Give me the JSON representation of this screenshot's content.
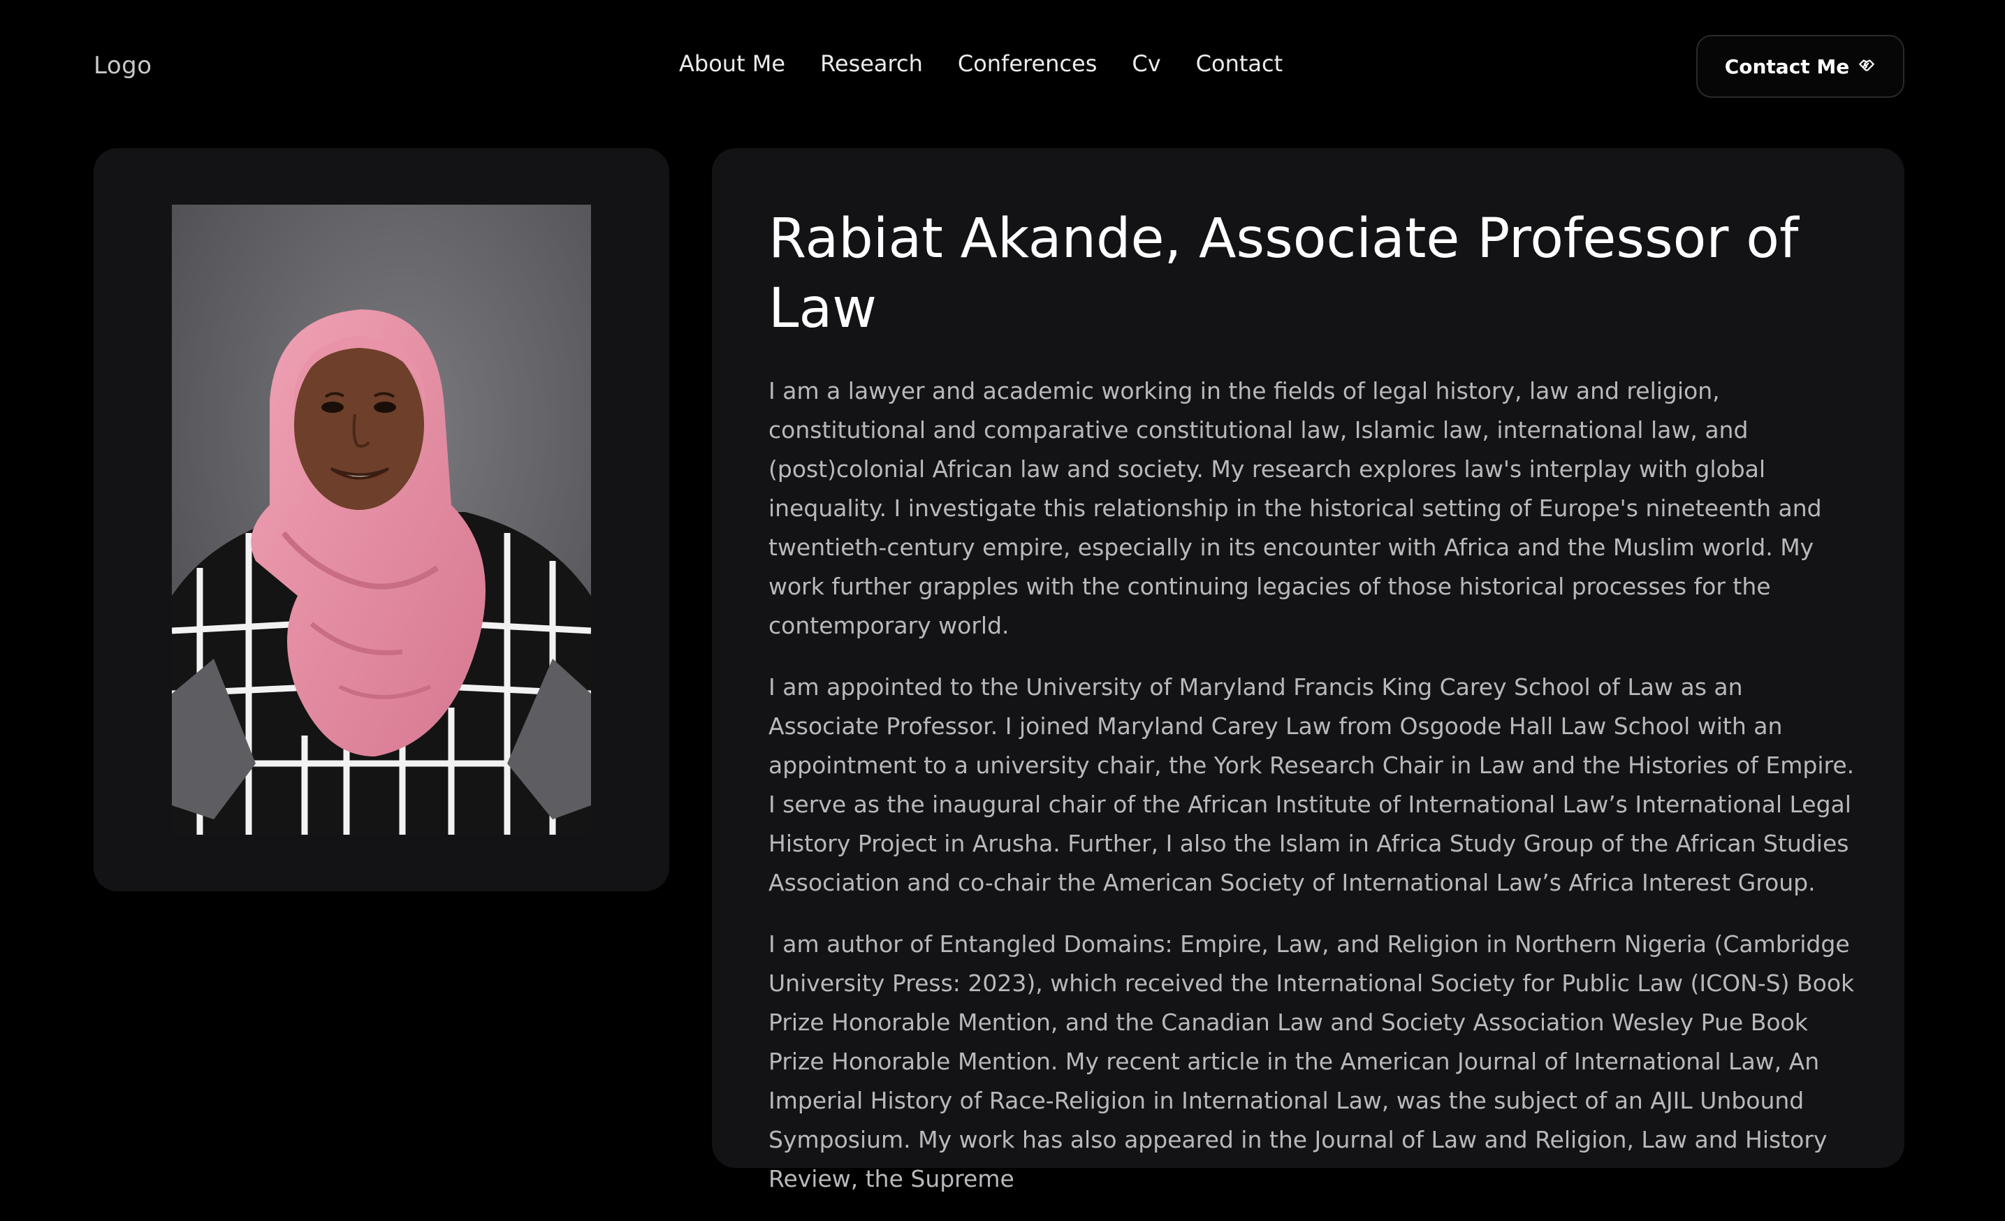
{
  "header": {
    "logo": "Logo",
    "nav": [
      "About Me",
      "Research",
      "Conferences",
      "Cv",
      "Contact"
    ],
    "cta_label": "Contact Me",
    "cta_icon": "handshake-icon"
  },
  "profile": {
    "title": "Rabiat Akande, Associate Professor of Law",
    "paragraphs": [
      "I am a lawyer and academic working in the fields of legal history, law and religion, constitutional and comparative constitutional law, Islamic law, international law, and (post)colonial African law and society. My research explores law's interplay with global inequality. I investigate this relationship in the historical setting of Europe's nineteenth and twentieth-century empire, especially in its encounter with Africa and the Muslim world. My work further grapples with the continuing legacies of those historical processes for the contemporary world.",
      "I am appointed to the University of Maryland Francis King Carey School of Law as an Associate Professor. I joined Maryland Carey Law from Osgoode Hall Law School with an appointment to a university chair, the York Research Chair in Law and the Histories of Empire. I serve as the inaugural chair of the African Institute of International Law’s International Legal History Project in Arusha. Further, I also the Islam in Africa Study Group of the African Studies Association and co-chair the American Society of International Law’s Africa Interest Group.",
      "I am author of Entangled Domains: Empire, Law, and Religion in Northern Nigeria (Cambridge University Press: 2023), which received the International Society for Public Law (ICON-S) Book Prize Honorable Mention, and the Canadian Law and Society Association Wesley Pue Book Prize Honorable Mention. My recent article in the American Journal of International Law, An Imperial History of Race-Religion in International Law, was the subject of an AJIL Unbound Symposium. My work has also appeared in the Journal of Law and Religion, Law and History Review, the Supreme"
    ]
  },
  "colors": {
    "background": "#000000",
    "card": "#131316",
    "body_text": "#b9b9bd",
    "headscarf": "#e58aa0"
  }
}
